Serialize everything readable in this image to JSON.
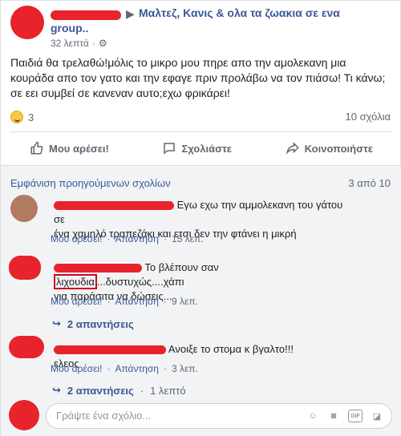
{
  "post": {
    "group_line1": "Μαλτεζ, Κανις & ολα τα ζωακια σε ενα",
    "group_line2": "group..",
    "time": "32 λεπτά",
    "privacy_icon": "gear-icon",
    "text": "Παιδιά θα τρελαθώ!μόλις το μικρο μου πηρε απο την αμολεκανη μια κουράδα απο τον γατο και την εφαγε πριν προλάβω να τον πιάσω! Τι κάνω; σε εει συμβεί σε κανεναν αυτο;εχω φρικάρει!",
    "reactions_count": "3",
    "comments_count": "10 σχόλια"
  },
  "actions": {
    "like": "Μου αρέσει!",
    "comment": "Σχολιάστε",
    "share": "Κοινοποιήστε"
  },
  "comments_header": {
    "previous": "Εμφάνιση προηγούμενων σχολίων",
    "paging": "3 από 10"
  },
  "comments": [
    {
      "text_line1": "Εγω εχω την αμμολεκανη του γάτου σε",
      "text_line2": "ένα χαμηλό τραπεζάκι και ετσι δεν την φτάνει η μικρή",
      "like": "Μου αρέσει!",
      "reply": "Απάντηση",
      "time": "15 λεπ."
    },
    {
      "text_pre": "Το βλέπουν σαν",
      "text_boxed": "λιχουδια",
      "text_post": "...δυστυχώς....χάπι",
      "text_line2": "για παράσιτα να δώσεις...",
      "like": "Μου αρέσει!",
      "reply": "Απάντηση",
      "time": "9 λεπ.",
      "replies": "2 απαντήσεις"
    },
    {
      "text": "Ανοιξε το στομα κ βγαλτο!!!ελεος",
      "like": "Μου αρέσει!",
      "reply": "Απάντηση",
      "time": "3 λεπ.",
      "replies": "2 απαντήσεις",
      "replies_time": "1 λεπτό"
    }
  ],
  "composer": {
    "placeholder": "Γράψτε ένα σχόλιο..."
  },
  "colors": {
    "link": "#385898",
    "redaction": "#e8232b"
  }
}
